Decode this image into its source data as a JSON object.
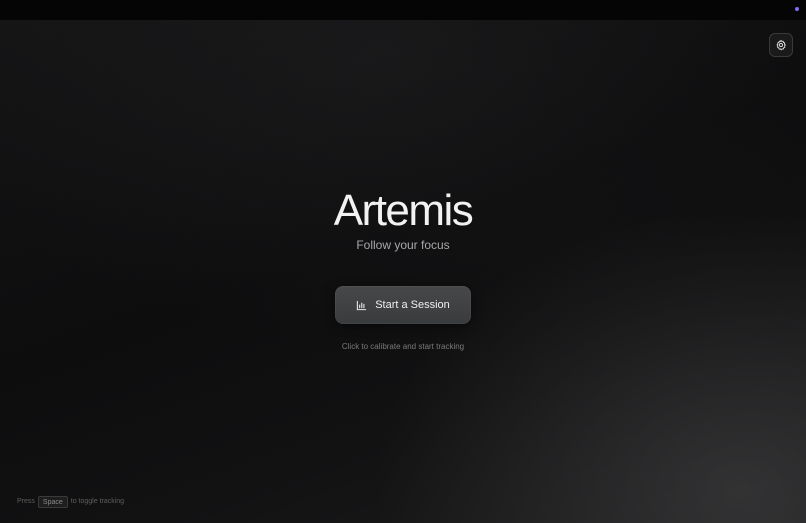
{
  "app": {
    "title": "Artemis",
    "tagline": "Follow your focus"
  },
  "actions": {
    "start_label": "Start a Session",
    "start_icon": "bar-chart-icon",
    "settings_icon": "gear-icon"
  },
  "hint": "Click to calibrate and start tracking",
  "shortcut": {
    "prefix": "Press",
    "key": "Space",
    "suffix": "to toggle tracking"
  },
  "colors": {
    "accent_dot": "#7c6ff0",
    "background": "#0a0a0b",
    "button": "#3f4042"
  }
}
